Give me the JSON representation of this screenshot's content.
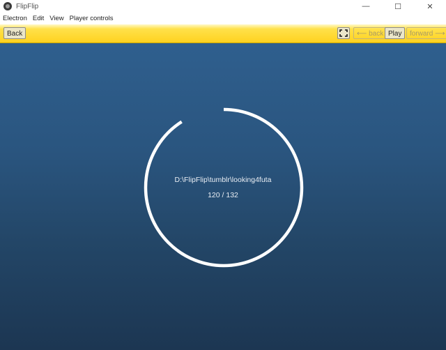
{
  "window": {
    "title": "FlipFlip",
    "app_icon": "flipflip-app-icon",
    "controls": {
      "minimize": "—",
      "maximize": "☐",
      "close": "✕"
    }
  },
  "menubar": {
    "items": [
      "Electron",
      "Edit",
      "View",
      "Player controls"
    ]
  },
  "toolbar": {
    "back_label": "Back",
    "fullscreen_icon": "fullscreen-icon",
    "history_back_label": "⟵ back",
    "play_label": "Play",
    "history_forward_label": "forward ⟶"
  },
  "loader": {
    "path": "D:\\FlipFlip\\tumblr\\looking4futa",
    "count": "120 / 132",
    "loaded": 120,
    "total": 132
  },
  "colors": {
    "toolbar_accent": "#ffd21f",
    "stage_top": "#2f5f8e",
    "stage_bottom": "#1c3652",
    "ring": "#ffffff"
  }
}
